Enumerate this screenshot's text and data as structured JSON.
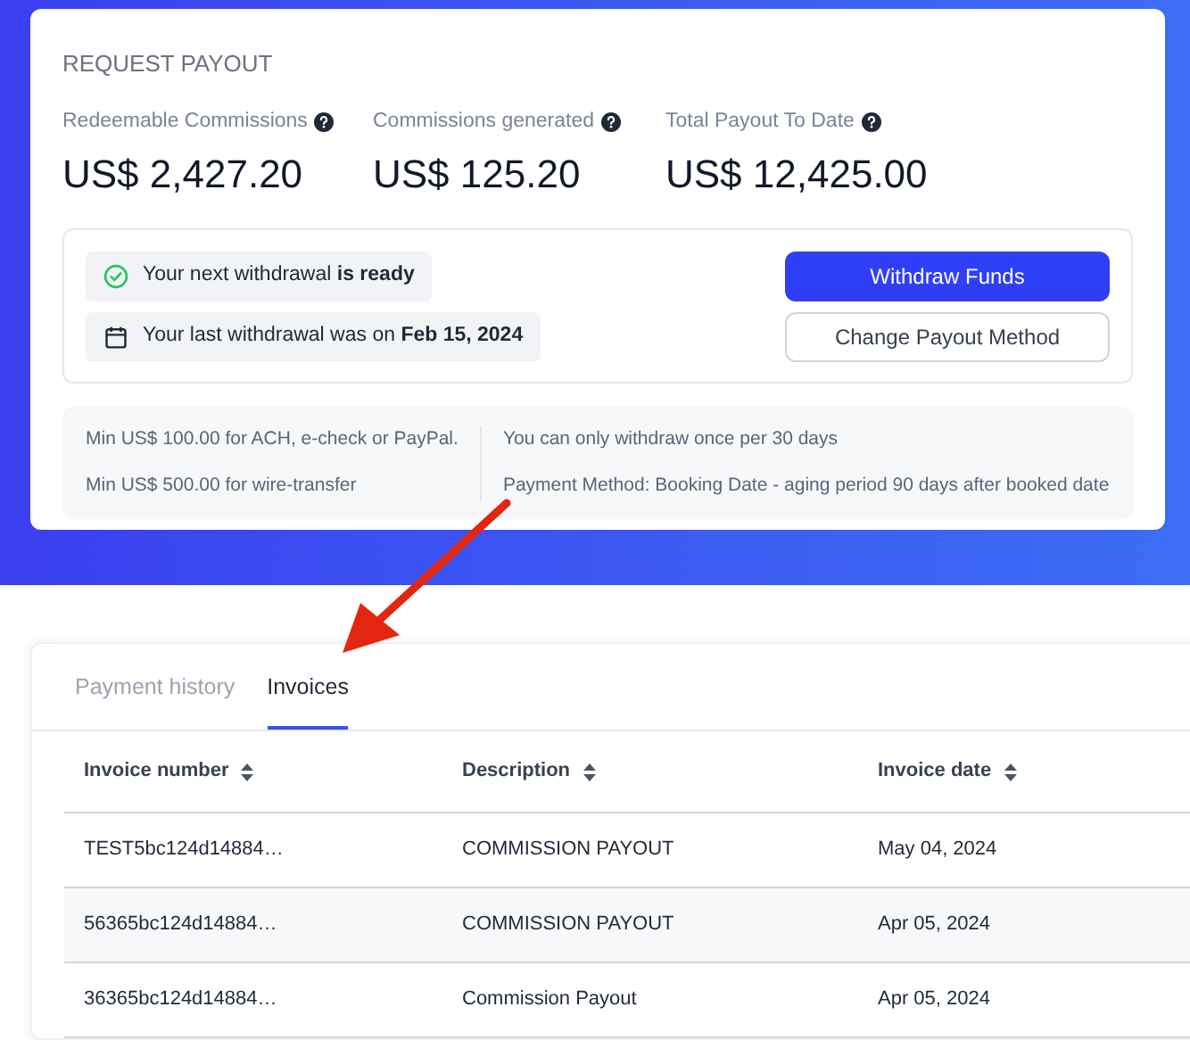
{
  "payout": {
    "title": "REQUEST PAYOUT",
    "stats": [
      {
        "label": "Redeemable Commissions",
        "value": "US$ 2,427.20"
      },
      {
        "label": "Commissions generated",
        "value": "US$ 125.20"
      },
      {
        "label": "Total Payout To Date",
        "value": "US$ 12,425.00"
      }
    ],
    "notices": [
      {
        "kind": "ready",
        "text": "Your next withdrawal **is ready**"
      },
      {
        "kind": "last",
        "text": "Your last withdrawal was on **Feb 15, 2024**"
      }
    ],
    "buttons": [
      {
        "kind": "primary",
        "label": "Withdraw Funds"
      },
      {
        "kind": "secondary",
        "label": "Change Payout Method"
      }
    ],
    "rules_left": [
      "Min US$ 100.00 for ACH, e-check or PayPal.",
      "Min US$ 500.00 for wire-transfer"
    ],
    "rules_right": [
      "You can only withdraw once per 30 days",
      "Payment Method: Booking Date - aging period 90 days after booked date"
    ]
  },
  "tabs": [
    {
      "label": "Payment history",
      "selected": false
    },
    {
      "label": "Invoices",
      "selected": true
    }
  ],
  "table": {
    "columns": [
      "Invoice number",
      "Description",
      "Invoice date"
    ],
    "rows": [
      [
        "TEST5bc124d14884…",
        "COMMISSION PAYOUT",
        "May 04, 2024"
      ],
      [
        "56365bc124d14884…",
        "COMMISSION PAYOUT",
        "Apr 05, 2024"
      ],
      [
        "36365bc124d14884…",
        "Commission Payout",
        "Apr 05, 2024"
      ]
    ]
  }
}
